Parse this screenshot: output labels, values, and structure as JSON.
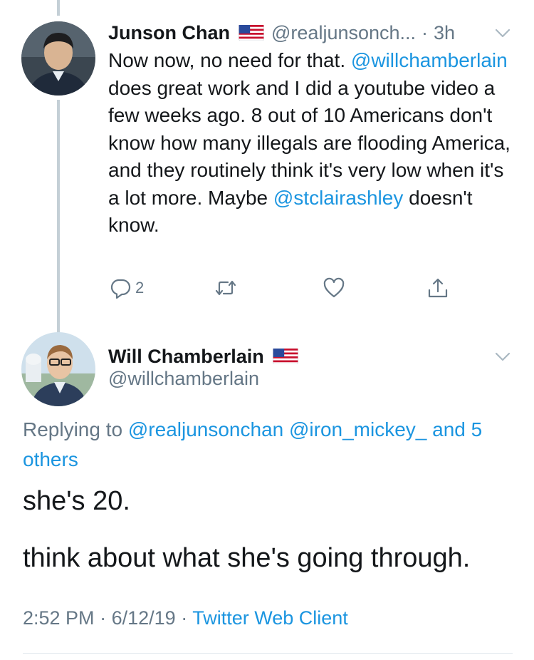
{
  "colors": {
    "link": "#1b95e0",
    "secondary_text": "#657786",
    "primary_text": "#14171a",
    "thread_line": "#c4cfd6"
  },
  "tweet1": {
    "display_name": "Junson Chan",
    "flag_icon": "us-flag-icon",
    "handle": "@realjunsonch...",
    "separator": "·",
    "time": "3h",
    "text_parts": [
      "Now now, no need for that. ",
      "@willchamberlain",
      " does great work and I did a youtube video a few weeks ago. 8 out of 10 Americans don't know how many illegals are flooding America, and they routinely think it's very low when it's a lot more. Maybe ",
      "@stclairashley",
      " doesn't know."
    ],
    "reply_count": "2",
    "icons": [
      "reply-icon",
      "retweet-icon",
      "like-icon",
      "share-icon",
      "chevron-down-icon"
    ]
  },
  "tweet2": {
    "display_name": "Will Chamberlain",
    "flag_icon": "us-flag-icon",
    "handle": "@willchamberlain",
    "replying_prefix": "Replying to ",
    "replying_mentions": "@realjunsonchan @iron_mickey_ and 5 others",
    "text_line1": "she's 20.",
    "text_line2": "think about what she's going through.",
    "time": "2:52 PM",
    "date": "6/12/19",
    "separator": "·",
    "source": "Twitter Web Client"
  }
}
